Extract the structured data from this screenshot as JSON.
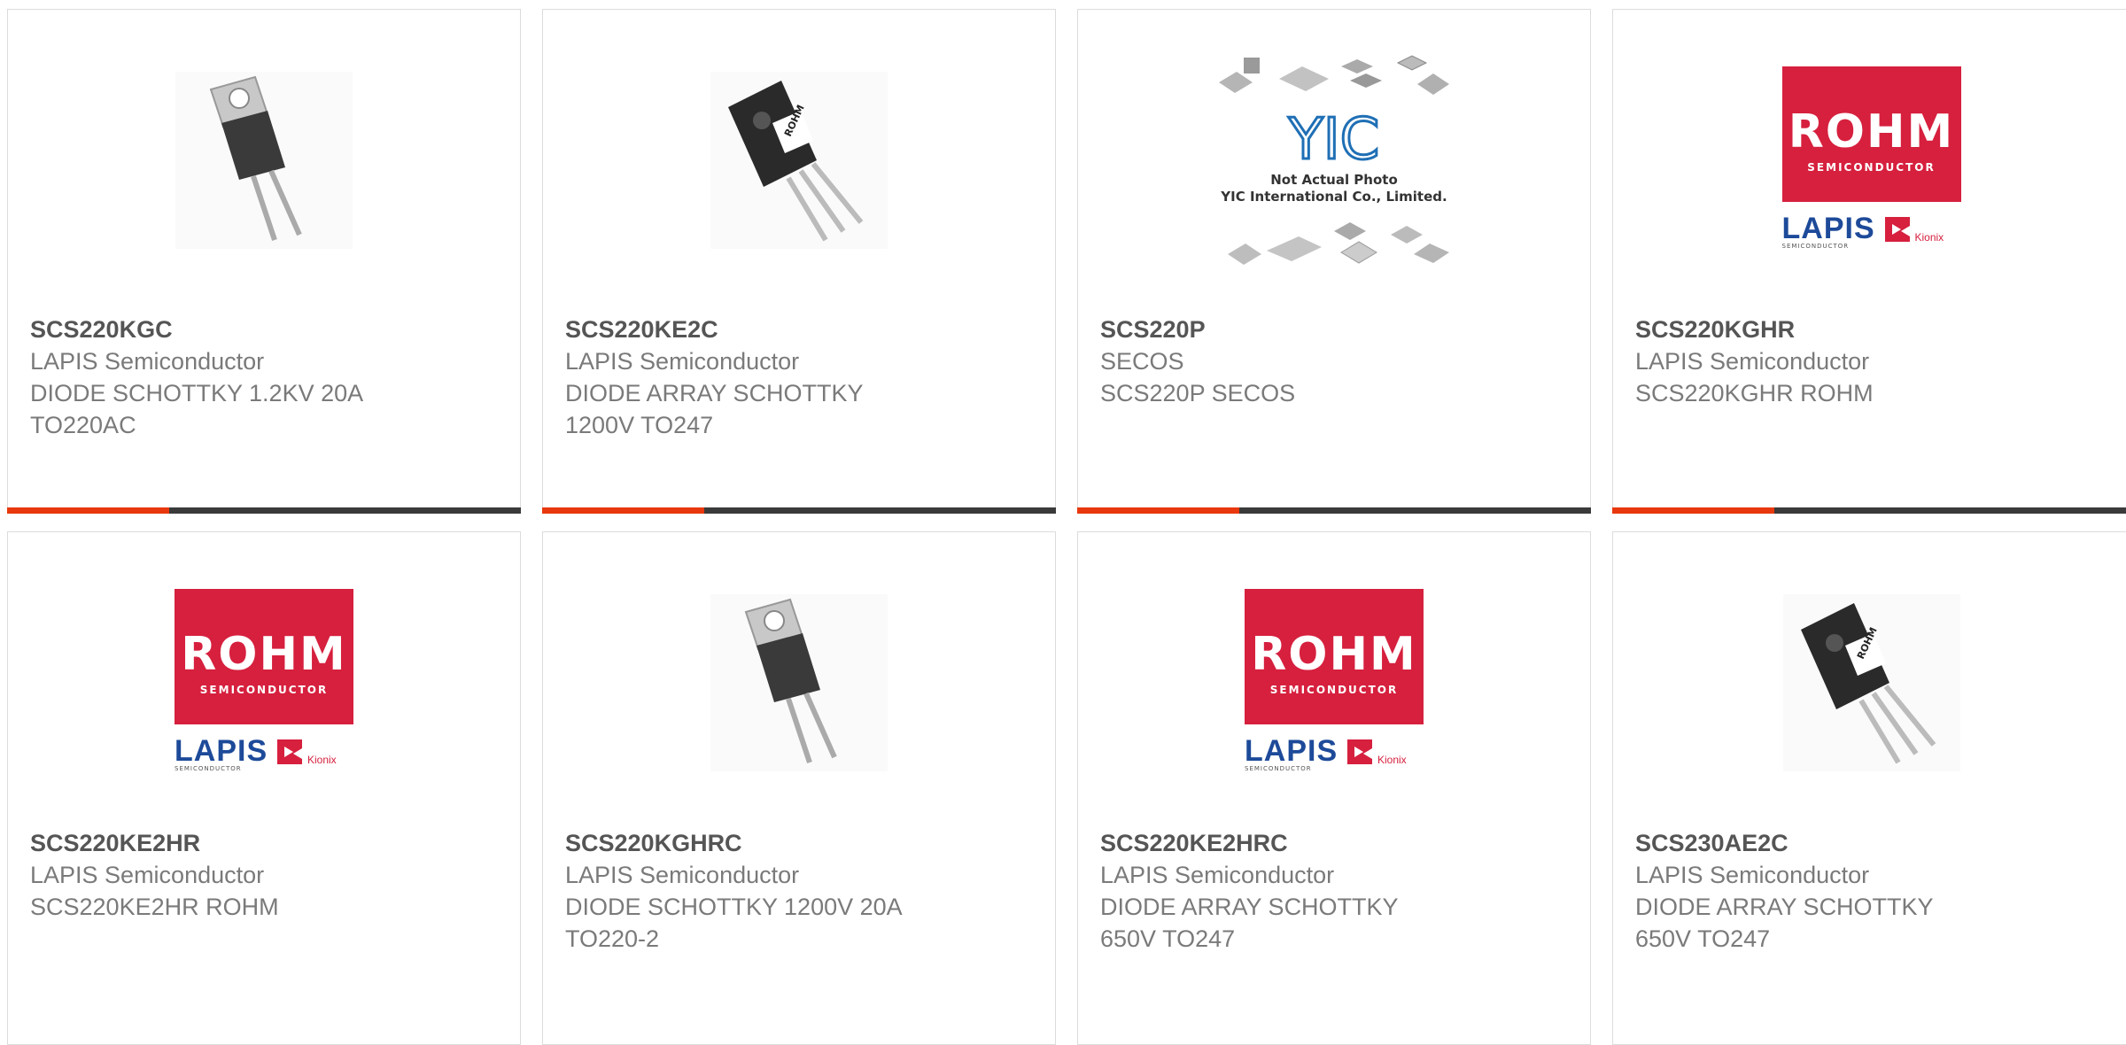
{
  "products": [
    {
      "part": "SCS220KGC",
      "manufacturer": "LAPIS Semiconductor",
      "desc1": "DIODE SCHOTTKY 1.2KV 20A",
      "desc2": "TO220AC",
      "image": "to220-diode-photo"
    },
    {
      "part": "SCS220KE2C",
      "manufacturer": "LAPIS Semiconductor",
      "desc1": "DIODE ARRAY SCHOTTKY",
      "desc2": "1200V TO247",
      "image": "to247-photo"
    },
    {
      "part": "SCS220P",
      "manufacturer": "SECOS",
      "desc1": "SCS220P SECOS",
      "desc2": "",
      "image": "yic-placeholder"
    },
    {
      "part": "SCS220KGHR",
      "manufacturer": "LAPIS Semiconductor",
      "desc1": "SCS220KGHR ROHM",
      "desc2": "",
      "image": "rohm-logo"
    },
    {
      "part": "SCS220KE2HR",
      "manufacturer": "LAPIS Semiconductor",
      "desc1": "SCS220KE2HR ROHM",
      "desc2": "",
      "image": "rohm-logo"
    },
    {
      "part": "SCS220KGHRC",
      "manufacturer": "LAPIS Semiconductor",
      "desc1": "DIODE SCHOTTKY 1200V 20A",
      "desc2": "TO220-2",
      "image": "to220-diode-photo"
    },
    {
      "part": "SCS220KE2HRC",
      "manufacturer": "LAPIS Semiconductor",
      "desc1": "DIODE ARRAY SCHOTTKY",
      "desc2": "650V TO247",
      "image": "rohm-logo"
    },
    {
      "part": "SCS230AE2C",
      "manufacturer": "LAPIS Semiconductor",
      "desc1": "DIODE ARRAY SCHOTTKY",
      "desc2": "650V TO247",
      "image": "to247-photo"
    }
  ],
  "yic_placeholder": {
    "line1": "Not Actual Photo",
    "line2": "YIC International Co., Limited.",
    "logo": "YIC"
  },
  "rohm_logo": {
    "brand": "ROHM",
    "sub": "SEMICONDUCTOR",
    "lapis": "LAPIS",
    "lapis_sub": "SEMICONDUCTOR",
    "kionix": "Kionix"
  },
  "colors": {
    "accent": "#e8380d",
    "bar": "#3a3a3a",
    "rohm_red": "#d6203e",
    "lapis_blue": "#1d4a99"
  }
}
